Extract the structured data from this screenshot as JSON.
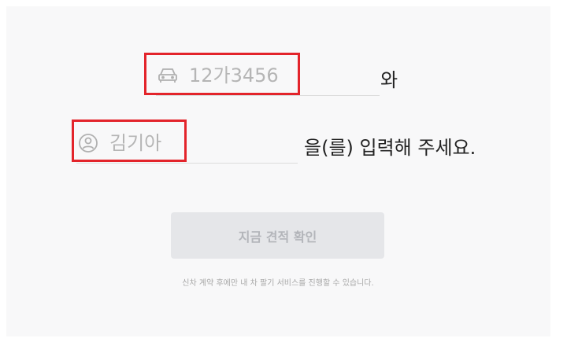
{
  "form": {
    "plate": {
      "placeholder": "12가3456",
      "value": "",
      "icon": "car-icon",
      "suffix": "와"
    },
    "owner": {
      "placeholder": "김기아",
      "value": "",
      "icon": "user-circle-icon",
      "suffix": "을(를) 입력해 주세요."
    },
    "submit_label": "지금 견적 확인",
    "notice": "신차 계약 후에만 내 차 팔기 서비스를 진행할 수 있습니다."
  },
  "colors": {
    "highlight": "#e3242b",
    "button_bg": "#e5e6e9",
    "button_text": "#b3b5ba",
    "panel_bg": "#f8f8f9"
  }
}
